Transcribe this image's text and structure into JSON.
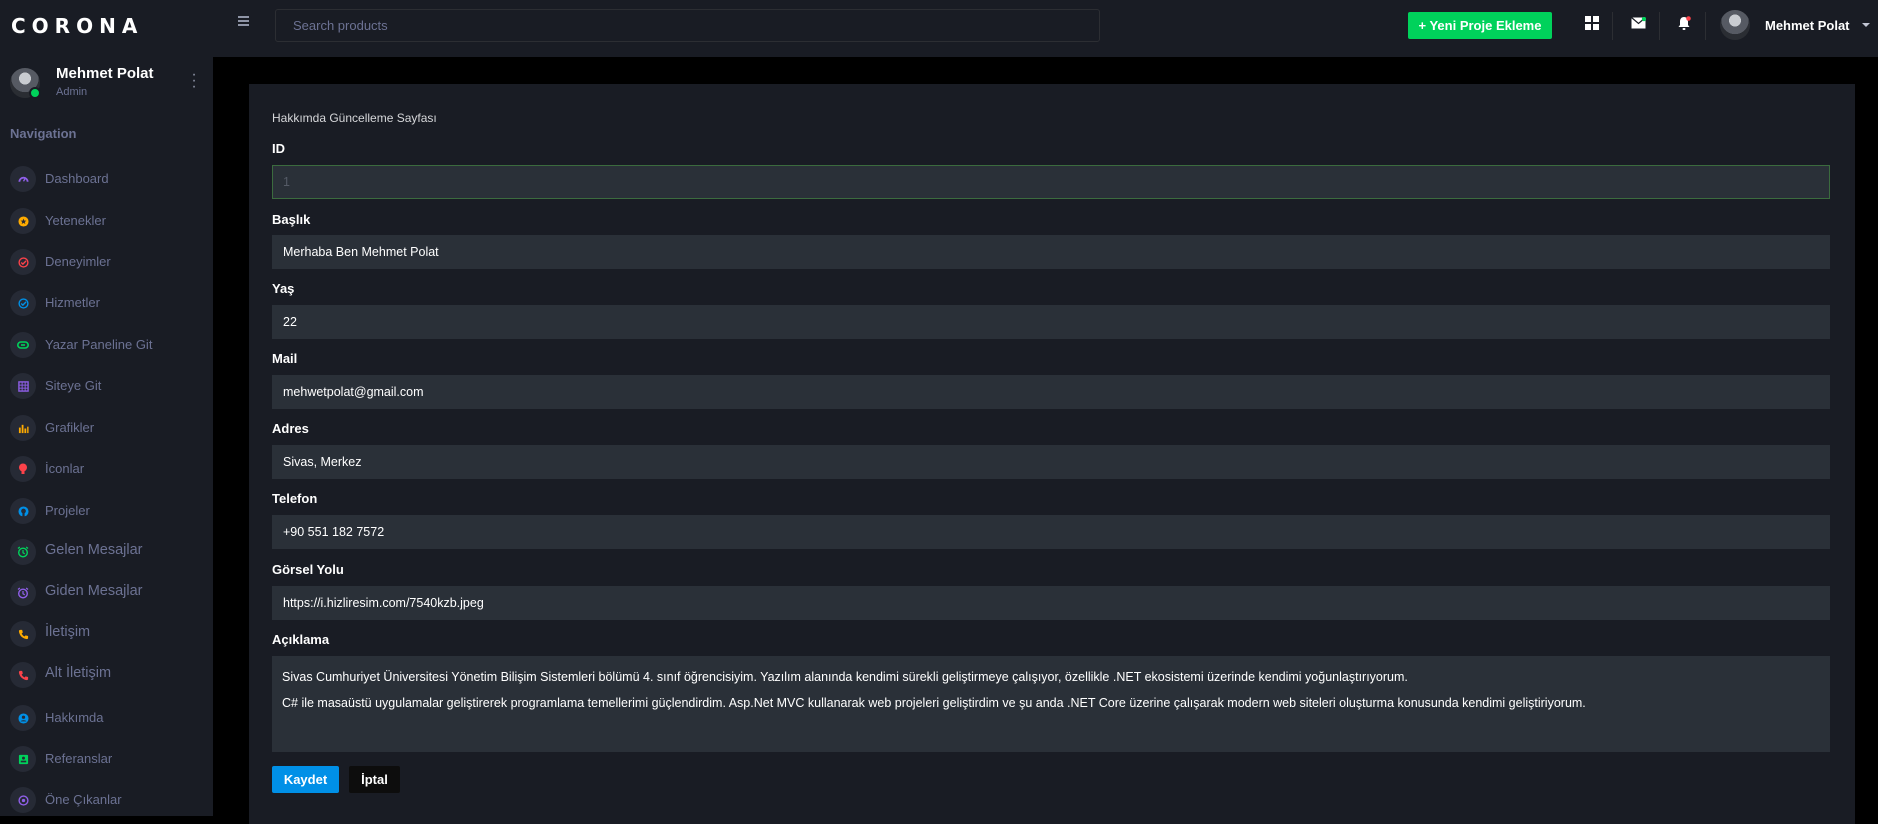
{
  "brand": "CORONA",
  "sidebar": {
    "profile": {
      "name": "Mehmet Polat",
      "role": "Admin"
    },
    "nav_title": "Navigation",
    "items": [
      {
        "label": "Dashboard",
        "icon": "speedometer-icon",
        "color": "#8f5fe8"
      },
      {
        "label": "Yetenekler",
        "icon": "star-icon",
        "color": "#ffab00"
      },
      {
        "label": "Deneyimler",
        "icon": "check-circle-icon",
        "color": "#fc424a"
      },
      {
        "label": "Hizmetler",
        "icon": "check-circle-icon",
        "color": "#0090e7"
      },
      {
        "label": "Yazar Paneline Git",
        "icon": "link-icon",
        "color": "#00d25b"
      },
      {
        "label": "Siteye Git",
        "icon": "table-icon",
        "color": "#8f5fe8"
      },
      {
        "label": "Grafikler",
        "icon": "bar-chart-icon",
        "color": "#ffab00"
      },
      {
        "label": "İconlar",
        "icon": "lightbulb-icon",
        "color": "#fc424a"
      },
      {
        "label": "Projeler",
        "icon": "github-icon",
        "color": "#0090e7"
      },
      {
        "label": "Gelen Mesajlar",
        "icon": "alarm-icon",
        "color": "#00d25b"
      },
      {
        "label": "Giden Mesajlar",
        "icon": "alarm-icon",
        "color": "#8f5fe8"
      },
      {
        "label": "İletişim",
        "icon": "phone-icon",
        "color": "#ffab00"
      },
      {
        "label": "Alt İletişim",
        "icon": "phone-icon",
        "color": "#fc424a"
      },
      {
        "label": "Hakkımda",
        "icon": "account-icon",
        "color": "#0090e7"
      },
      {
        "label": "Referanslar",
        "icon": "contact-card-icon",
        "color": "#00d25b"
      },
      {
        "label": "Öne Çıkanlar",
        "icon": "play-circle-icon",
        "color": "#8f5fe8"
      }
    ]
  },
  "topbar": {
    "search_placeholder": "Search products",
    "new_project_label": "+ Yeni Proje Ekleme",
    "user_name": "Mehmet Polat"
  },
  "form": {
    "title": "Hakkımda Güncelleme Sayfası",
    "id_label": "ID",
    "id_value": "1",
    "baslik_label": "Başlık",
    "baslik_value": "Merhaba Ben Mehmet Polat",
    "yas_label": "Yaş",
    "yas_value": "22",
    "mail_label": "Mail",
    "mail_value": "mehwetpolat@gmail.com",
    "adres_label": "Adres",
    "adres_value": "Sivas, Merkez",
    "telefon_label": "Telefon",
    "telefon_value": "+90 551 182 7572",
    "gorsel_label": "Görsel Yolu",
    "gorsel_value": "https://i.hizliresim.com/7540kzb.jpeg",
    "aciklama_label": "Açıklama",
    "aciklama_line1": "Sivas Cumhuriyet Üniversitesi Yönetim Bilişim Sistemleri bölümü 4. sınıf öğrencisiyim. Yazılım alanında kendimi sürekli geliştirmeye çalışıyor, özellikle .NET ekosistemi üzerinde kendimi yoğunlaştırıyorum.",
    "aciklama_line2": "C# ile masaüstü uygulamalar geliştirerek programlama temellerimi güçlendirdim. Asp.Net MVC kullanarak web projeleri geliştirdim ve şu anda .NET Core üzerine çalışarak modern web siteleri oluşturma konusunda kendimi geliştiriyorum.",
    "save_label": "Kaydet",
    "cancel_label": "İptal"
  },
  "colors": {
    "green": "#00d25b",
    "blue": "#0090e7",
    "notification_dot": "#fc424a"
  }
}
